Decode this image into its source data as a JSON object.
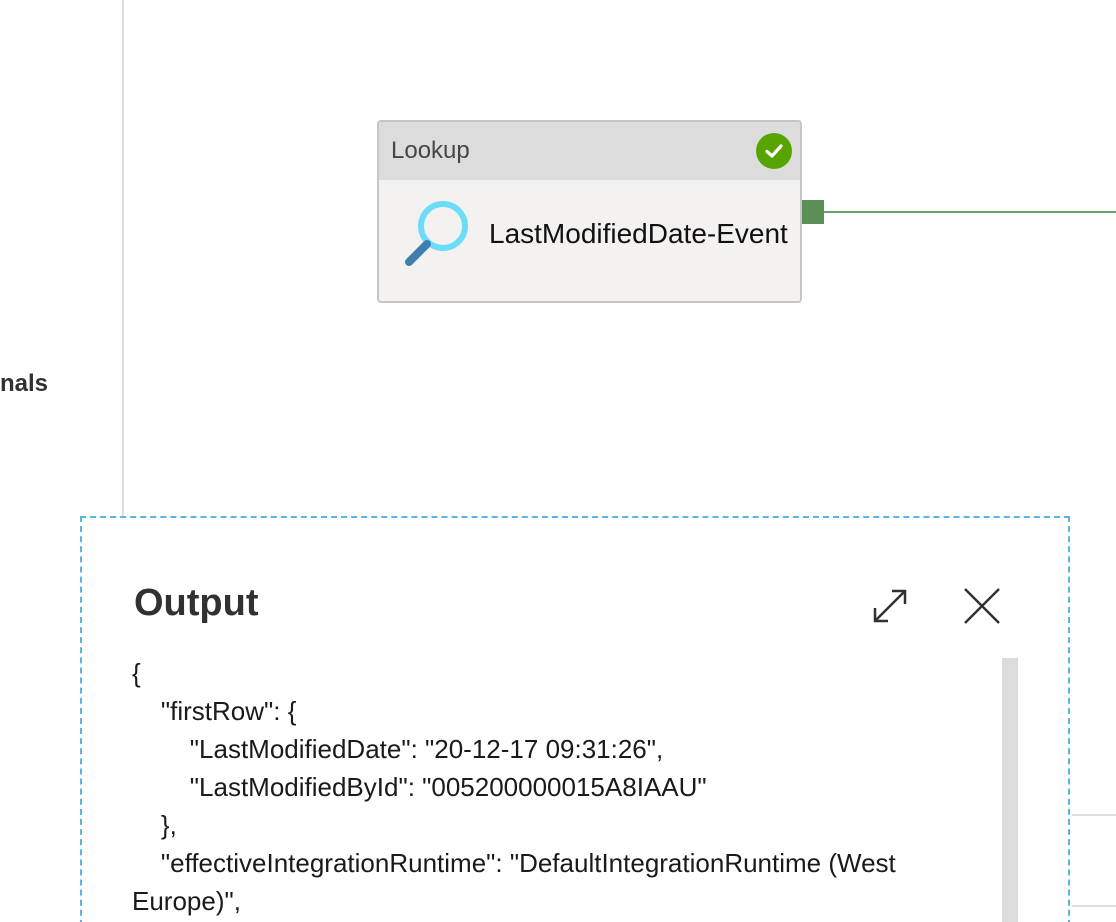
{
  "left_panel": {
    "partial_label": "nals"
  },
  "activity": {
    "type_label": "Lookup",
    "name": "LastModifiedDate-Event",
    "status": "succeeded",
    "status_icon": "check-circle-icon",
    "icon": "magnifier-icon",
    "colors": {
      "status": "#57a300",
      "connector": "#6aa067"
    }
  },
  "output": {
    "title": "Output",
    "expand_icon": "expand-arrows-icon",
    "close_icon": "close-icon",
    "json_lines": [
      "{",
      "    \"firstRow\": {",
      "        \"LastModifiedDate\": \"20-12-17 09:31:26\",",
      "        \"LastModifiedById\": \"005200000015A8IAAU\"",
      "    },",
      "    \"effectiveIntegrationRuntime\": \"DefaultIntegrationRuntime (West",
      "Europe)\","
    ]
  }
}
